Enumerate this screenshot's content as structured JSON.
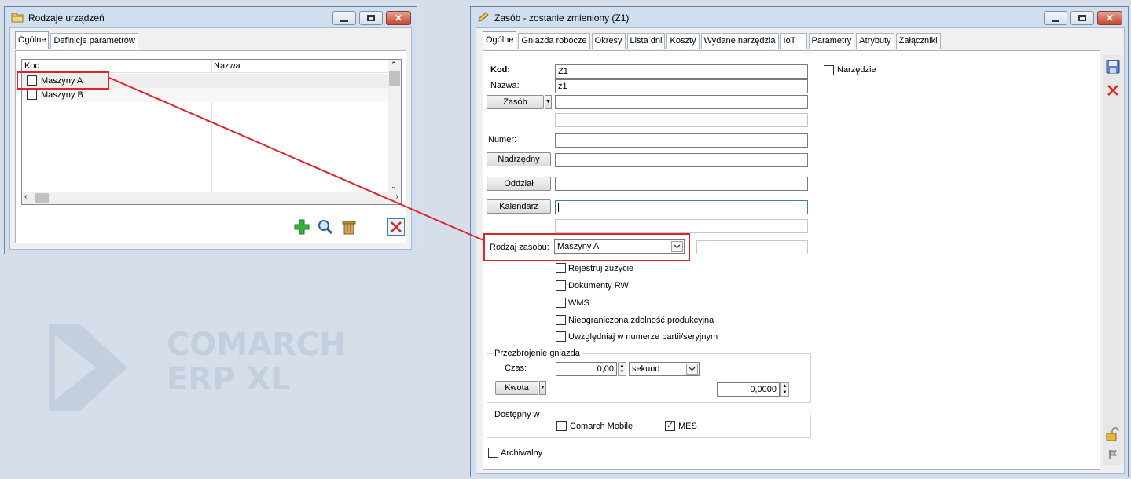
{
  "watermark": {
    "line1": "COMARCH",
    "line2": "ERP XL"
  },
  "left_window": {
    "title": "Rodzaje urządzeń",
    "tabs": [
      {
        "label": "Ogólne"
      },
      {
        "label": "Definicje parametrów"
      }
    ],
    "columns": [
      "Kod",
      "Nazwa"
    ],
    "rows": [
      {
        "kod": "Maszyny A"
      },
      {
        "kod": "Maszyny B"
      }
    ],
    "toolbar_icons": [
      "add-icon",
      "search-icon",
      "delete-icon",
      "close-icon"
    ]
  },
  "right_window": {
    "title": "Zasób - zostanie zmieniony  (Z1)",
    "tabs": [
      {
        "label": "Ogólne"
      },
      {
        "label": "Gniazda robocze"
      },
      {
        "label": "Okresy"
      },
      {
        "label": "Lista dni"
      },
      {
        "label": "Koszty"
      },
      {
        "label": "Wydane narzędzia"
      },
      {
        "label": "IoT"
      },
      {
        "label": "Parametry"
      },
      {
        "label": "Atrybuty"
      },
      {
        "label": "Załączniki"
      }
    ],
    "form": {
      "kod_label": "Kod:",
      "kod_value": "Z1",
      "nazwa_label": "Nazwa:",
      "nazwa_value": "z1",
      "zasob_button": "Zasób",
      "numer_label": "Numer:",
      "nadrzedny_button": "Nadrzędny",
      "oddzial_button": "Oddział",
      "kalendarz_button": "Kalendarz",
      "rodzaj_label": "Rodzaj zasobu:",
      "rodzaj_value": "Maszyny A",
      "narzedzie_label": "Narzędzie",
      "narzedzie_checked": false,
      "checks": [
        {
          "label": "Rejestruj zużycie",
          "checked": false
        },
        {
          "label": "Dokumenty RW",
          "checked": false
        },
        {
          "label": "WMS",
          "checked": false
        },
        {
          "label": "Nieograniczona zdolność produkcyjna",
          "checked": false
        },
        {
          "label": "Uwzględniaj w numerze partii/seryjnym",
          "checked": false
        }
      ],
      "przezbrojenie": {
        "title": "Przezbrojenie gniazda",
        "czas_label": "Czas:",
        "czas_value": "0,00",
        "unit_value": "sekund",
        "kwota_button": "Kwota",
        "kwota_value": "0,0000"
      },
      "dostepny": {
        "title": "Dostępny w",
        "mobile_label": "Comarch Mobile",
        "mobile_checked": false,
        "mes_label": "MES",
        "mes_checked": true
      },
      "archiwalny_label": "Archiwalny",
      "archiwalny_checked": false
    },
    "side_icons": [
      "save-icon",
      "close-icon",
      "lock-icon",
      "flag-icon"
    ]
  },
  "colors": {
    "annotation_red": "#e0242b",
    "accent": "#3c7fb1"
  }
}
